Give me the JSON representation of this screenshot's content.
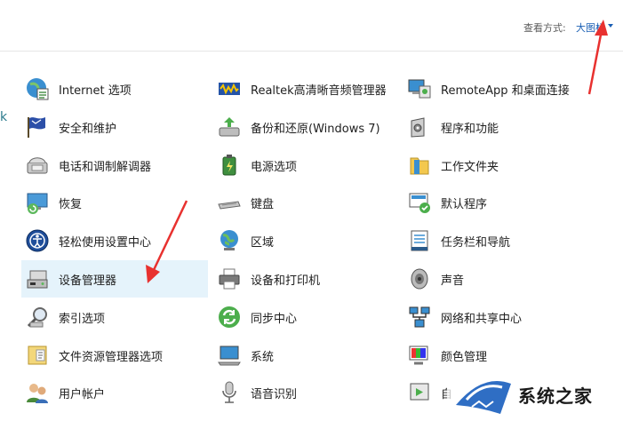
{
  "header": {
    "view_by_label": "查看方式:",
    "view_by_value": "大图标"
  },
  "columns": [
    {
      "items": [
        {
          "label": "Internet 选项",
          "icon": "internet-options-icon"
        },
        {
          "label": "安全和维护",
          "icon": "security-maintenance-flag-icon"
        },
        {
          "label": "电话和调制解调器",
          "icon": "phone-modem-icon"
        },
        {
          "label": "恢复",
          "icon": "recovery-icon"
        },
        {
          "label": "轻松使用设置中心",
          "icon": "ease-of-access-icon"
        },
        {
          "label": "设备管理器",
          "icon": "device-manager-icon",
          "selected": true
        },
        {
          "label": "索引选项",
          "icon": "indexing-options-icon"
        },
        {
          "label": "文件资源管理器选项",
          "icon": "file-explorer-options-icon"
        },
        {
          "label": "用户帐户",
          "icon": "user-accounts-icon"
        }
      ]
    },
    {
      "items": [
        {
          "label": "Realtek高清晰音频管理器",
          "icon": "realtek-audio-icon"
        },
        {
          "label": "备份和还原(Windows 7)",
          "icon": "backup-restore-icon"
        },
        {
          "label": "电源选项",
          "icon": "power-options-icon"
        },
        {
          "label": "键盘",
          "icon": "keyboard-icon"
        },
        {
          "label": "区域",
          "icon": "region-globe-icon"
        },
        {
          "label": "设备和打印机",
          "icon": "devices-printers-icon"
        },
        {
          "label": "同步中心",
          "icon": "sync-center-icon"
        },
        {
          "label": "系统",
          "icon": "system-icon"
        },
        {
          "label": "语音识别",
          "icon": "speech-recognition-icon"
        }
      ]
    },
    {
      "items": [
        {
          "label": "RemoteApp 和桌面连接",
          "icon": "remoteapp-icon"
        },
        {
          "label": "程序和功能",
          "icon": "programs-features-icon"
        },
        {
          "label": "工作文件夹",
          "icon": "work-folders-icon"
        },
        {
          "label": "默认程序",
          "icon": "default-programs-icon"
        },
        {
          "label": "任务栏和导航",
          "icon": "taskbar-navigation-icon"
        },
        {
          "label": "声音",
          "icon": "sound-icon"
        },
        {
          "label": "网络和共享中心",
          "icon": "network-sharing-icon"
        },
        {
          "label": "颜色管理",
          "icon": "color-management-icon"
        },
        {
          "label": "自",
          "icon": "autoplay-icon"
        }
      ]
    }
  ],
  "edge_fragment": "k",
  "watermark": {
    "text": "系统之家"
  },
  "colors": {
    "selected_bg": "#e5f3fb",
    "link": "#1a5fb4",
    "annotation_arrow": "#e8312f"
  }
}
